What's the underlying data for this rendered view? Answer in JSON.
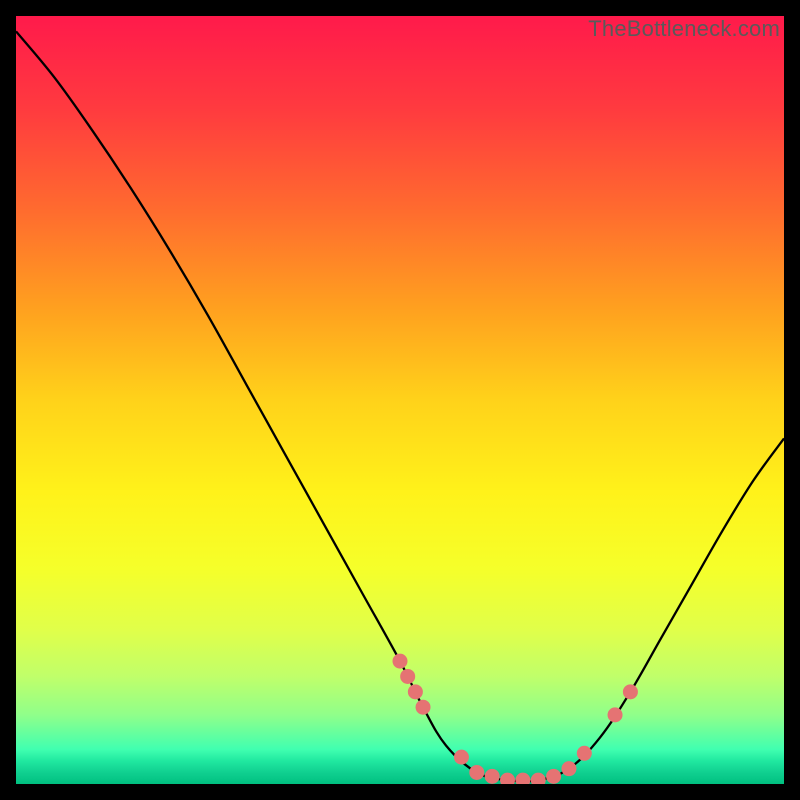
{
  "watermark": "TheBottleneck.com",
  "chart_data": {
    "type": "line",
    "title": "",
    "xlabel": "",
    "ylabel": "",
    "xlim": [
      0,
      100
    ],
    "ylim": [
      0,
      100
    ],
    "curve": {
      "x": [
        0,
        5,
        10,
        15,
        20,
        25,
        30,
        35,
        40,
        45,
        50,
        53,
        56,
        60,
        64,
        68,
        72,
        76,
        80,
        84,
        88,
        92,
        96,
        100
      ],
      "y": [
        98,
        92,
        85,
        77.5,
        69.5,
        61,
        52,
        43,
        34,
        25,
        16,
        10,
        5,
        1.5,
        0.5,
        0.5,
        2,
        6,
        12,
        19,
        26,
        33,
        39.5,
        45
      ]
    },
    "points": {
      "x": [
        50,
        51,
        52,
        53,
        58,
        60,
        62,
        64,
        66,
        68,
        70,
        72,
        74,
        78,
        80
      ],
      "y": [
        16,
        14,
        12,
        10,
        3.5,
        1.5,
        1,
        0.5,
        0.5,
        0.5,
        1,
        2,
        4,
        9,
        12
      ]
    },
    "gradient_stops": [
      {
        "offset": 0.0,
        "color": "#ff1a4b"
      },
      {
        "offset": 0.12,
        "color": "#ff3a3f"
      },
      {
        "offset": 0.25,
        "color": "#ff6a2f"
      },
      {
        "offset": 0.38,
        "color": "#ffa01f"
      },
      {
        "offset": 0.5,
        "color": "#ffd21a"
      },
      {
        "offset": 0.62,
        "color": "#fff21a"
      },
      {
        "offset": 0.72,
        "color": "#f5ff2a"
      },
      {
        "offset": 0.8,
        "color": "#e0ff4a"
      },
      {
        "offset": 0.86,
        "color": "#c0ff6a"
      },
      {
        "offset": 0.91,
        "color": "#90ff8a"
      },
      {
        "offset": 0.955,
        "color": "#40ffb0"
      },
      {
        "offset": 0.97,
        "color": "#20e8a0"
      },
      {
        "offset": 0.985,
        "color": "#10d090"
      },
      {
        "offset": 1.0,
        "color": "#00c080"
      }
    ],
    "point_color": "#e57373",
    "line_color": "#000000"
  }
}
